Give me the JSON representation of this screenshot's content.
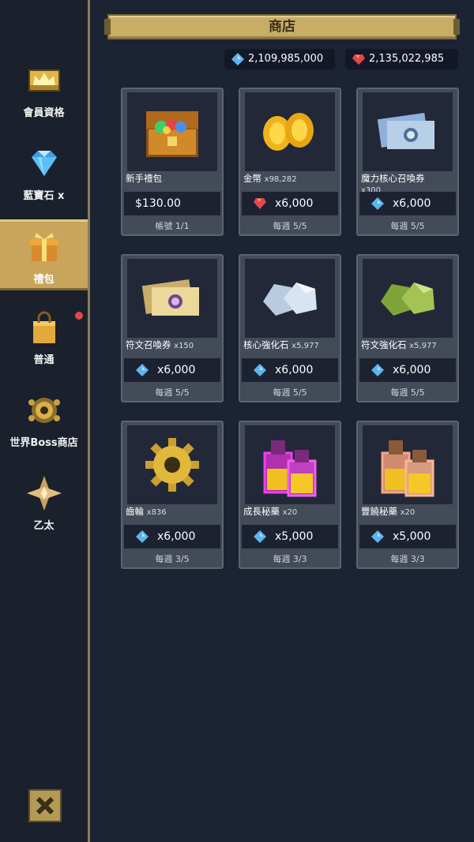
{
  "header": {
    "title": "商店"
  },
  "currencies": [
    {
      "icon": "blue-gem-icon",
      "amount": "2,109,985,000"
    },
    {
      "icon": "red-gem-icon",
      "amount": "2,135,022,985"
    }
  ],
  "sidebar": {
    "items": [
      {
        "label": "會員資格",
        "icon": "crown-icon"
      },
      {
        "label": "藍寶石 x",
        "icon": "diamond-icon"
      },
      {
        "label": "禮包",
        "icon": "gift-icon",
        "active": true
      },
      {
        "label": "普通",
        "icon": "shopping-bag-icon",
        "notification": true
      },
      {
        "label": "世界Boss商店",
        "icon": "boss-emblem-icon"
      },
      {
        "label": "乙太",
        "icon": "ether-star-icon"
      }
    ],
    "close_icon": "close-icon"
  },
  "shop": {
    "items": [
      {
        "name": "新手禮包",
        "qty": "",
        "price": "$130.00",
        "currency": "usd",
        "limit": "帳號 1/1",
        "icon": "treasure-chest-icon"
      },
      {
        "name": "金幣",
        "qty": "x98,282",
        "price": "x6,000",
        "currency": "red",
        "limit": "每週 5/5",
        "icon": "gold-coins-icon"
      },
      {
        "name": "魔力核心召喚券",
        "qty": "x300",
        "price": "x6,000",
        "currency": "blue",
        "limit": "每週 5/5",
        "icon": "summon-ticket-icon"
      },
      {
        "name": "符文召喚券",
        "qty": "x150",
        "price": "x6,000",
        "currency": "blue",
        "limit": "每週 5/5",
        "icon": "rune-ticket-icon"
      },
      {
        "name": "核心強化石",
        "qty": "x5,977",
        "price": "x6,000",
        "currency": "blue",
        "limit": "每週 5/5",
        "icon": "core-stone-icon"
      },
      {
        "name": "符文強化石",
        "qty": "x5,977",
        "price": "x6,000",
        "currency": "blue",
        "limit": "每週 5/5",
        "icon": "rune-stone-icon"
      },
      {
        "name": "齒輪",
        "qty": "x836",
        "price": "x6,000",
        "currency": "blue",
        "limit": "每週 3/5",
        "icon": "gear-icon"
      },
      {
        "name": "成長秘藥",
        "qty": "x20",
        "price": "x5,000",
        "currency": "blue",
        "limit": "每週 3/3",
        "icon": "growth-potion-icon"
      },
      {
        "name": "豐饒秘藥",
        "qty": "x20",
        "price": "x5,000",
        "currency": "blue",
        "limit": "每週 3/3",
        "icon": "abundance-potion-icon"
      }
    ]
  },
  "colors": {
    "accent": "#c8a55a",
    "blue_gem": "#5bb5f0",
    "red_gem": "#e04848",
    "background": "#1c2333"
  }
}
